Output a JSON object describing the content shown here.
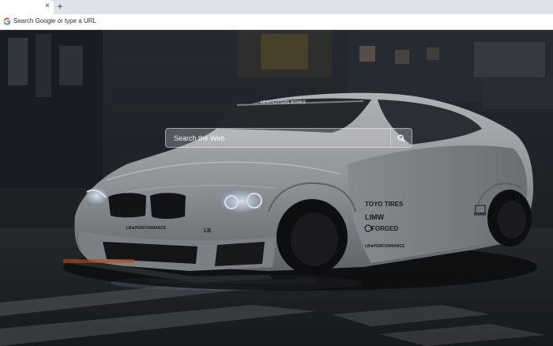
{
  "tabs": [
    {
      "label": "",
      "close_glyph": "×"
    }
  ],
  "new_tab_glyph": "+",
  "omnibox": {
    "placeholder": "Search Google or type a URL",
    "icon": "google-g-icon"
  },
  "search": {
    "placeholder": "Search the Web",
    "button_icon": "search-icon"
  },
  "wallpaper": {
    "subject": "white BMW M4 wide-body sports car",
    "badges": [
      "LB★PERFORMANCE",
      "TOYO TIRES",
      "FORGED",
      "LB★WORKS"
    ]
  },
  "colors": {
    "tabstrip": "#dee3ea",
    "toolbar": "#ffffff",
    "search_bar": "#e1e4eb"
  }
}
